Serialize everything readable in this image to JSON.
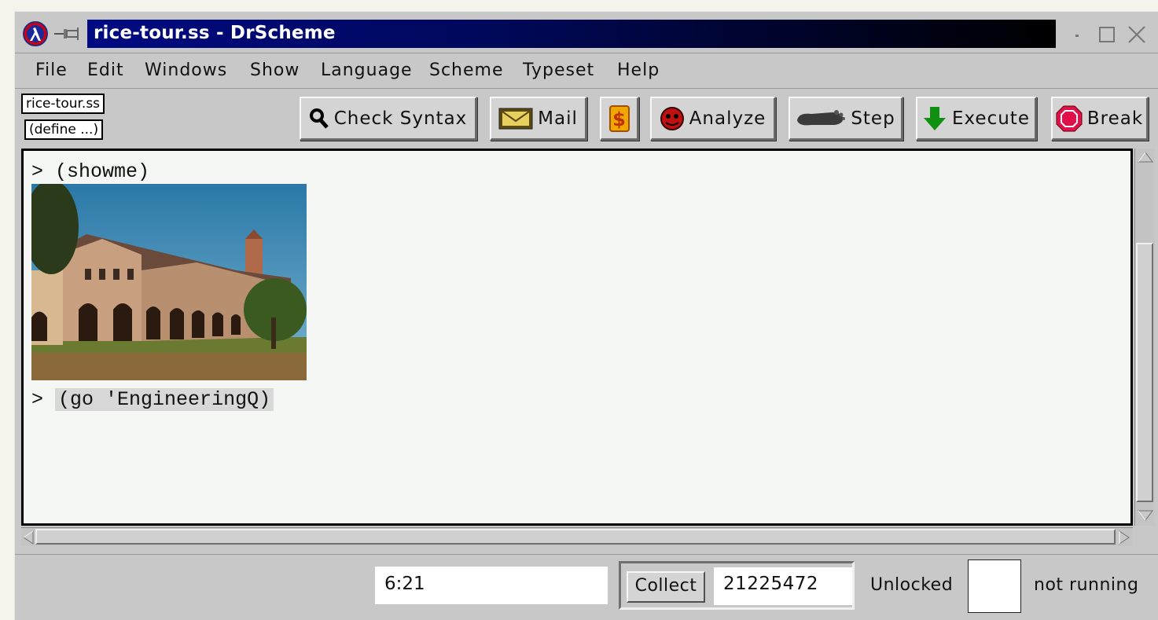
{
  "window": {
    "title": "rice-tour.ss - DrScheme"
  },
  "menu": {
    "items": [
      "File",
      "Edit",
      "Windows",
      "Show",
      "Language",
      "Scheme",
      "Typeset",
      "Help"
    ]
  },
  "toolbar": {
    "file_choice": "rice-tour.ss",
    "define_choice": "(define ...)",
    "check_syntax_label": "Check Syntax",
    "mail_label": "Mail",
    "analyze_label": "Analyze",
    "step_label": "Step",
    "execute_label": "Execute",
    "break_label": "Break",
    "icons": {
      "check_syntax": "magnifier-icon",
      "mail": "envelope-icon",
      "plugin": "dollar-ribbon-icon",
      "analyze": "spider-icon",
      "step": "foot-icon",
      "execute": "down-arrow-icon",
      "break": "stop-sign-icon"
    }
  },
  "interactions": {
    "prompt_symbol": ">",
    "lines": [
      {
        "expr": "(showme)"
      },
      {
        "expr": "(go 'EngineeringQ)",
        "selected": true
      }
    ]
  },
  "status": {
    "position": "6:21",
    "collect_label": "Collect",
    "memory": "21225472",
    "lock_state": "Unlocked",
    "run_state": "not running"
  },
  "colors": {
    "title_bar": "#000a82",
    "window_bg": "#c8c8c8",
    "editor_bg": "#f4f7f4"
  }
}
